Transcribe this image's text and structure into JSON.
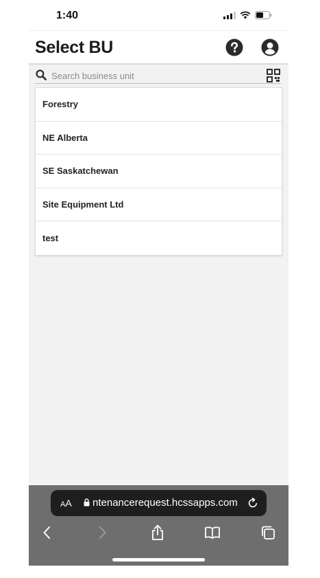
{
  "status_bar": {
    "time": "1:40",
    "icons": [
      "signal-icon",
      "wifi-icon",
      "battery-icon"
    ]
  },
  "header": {
    "title": "Select BU",
    "icons": [
      "help-icon",
      "account-icon"
    ]
  },
  "search": {
    "placeholder": "Search business unit",
    "value": "",
    "icon": "search-icon",
    "scan_icon": "qr-code-icon"
  },
  "business_units": [
    {
      "label": "Forestry"
    },
    {
      "label": "NE Alberta"
    },
    {
      "label": "SE Saskatchewan"
    },
    {
      "label": "Site Equipment Ltd"
    },
    {
      "label": "test"
    }
  ],
  "browser": {
    "text_size_label_small": "A",
    "text_size_label_large": "A",
    "url": "ntenancerequest.hcssapps.com",
    "icons": [
      "lock-icon",
      "reload-icon",
      "back-icon",
      "forward-icon",
      "share-icon",
      "bookmarks-icon",
      "tabs-icon"
    ]
  },
  "colors": {
    "content_background": "#f2f2f2",
    "browser_toolbar": "#6e6e6e",
    "url_pill": "#1e1e1e"
  }
}
